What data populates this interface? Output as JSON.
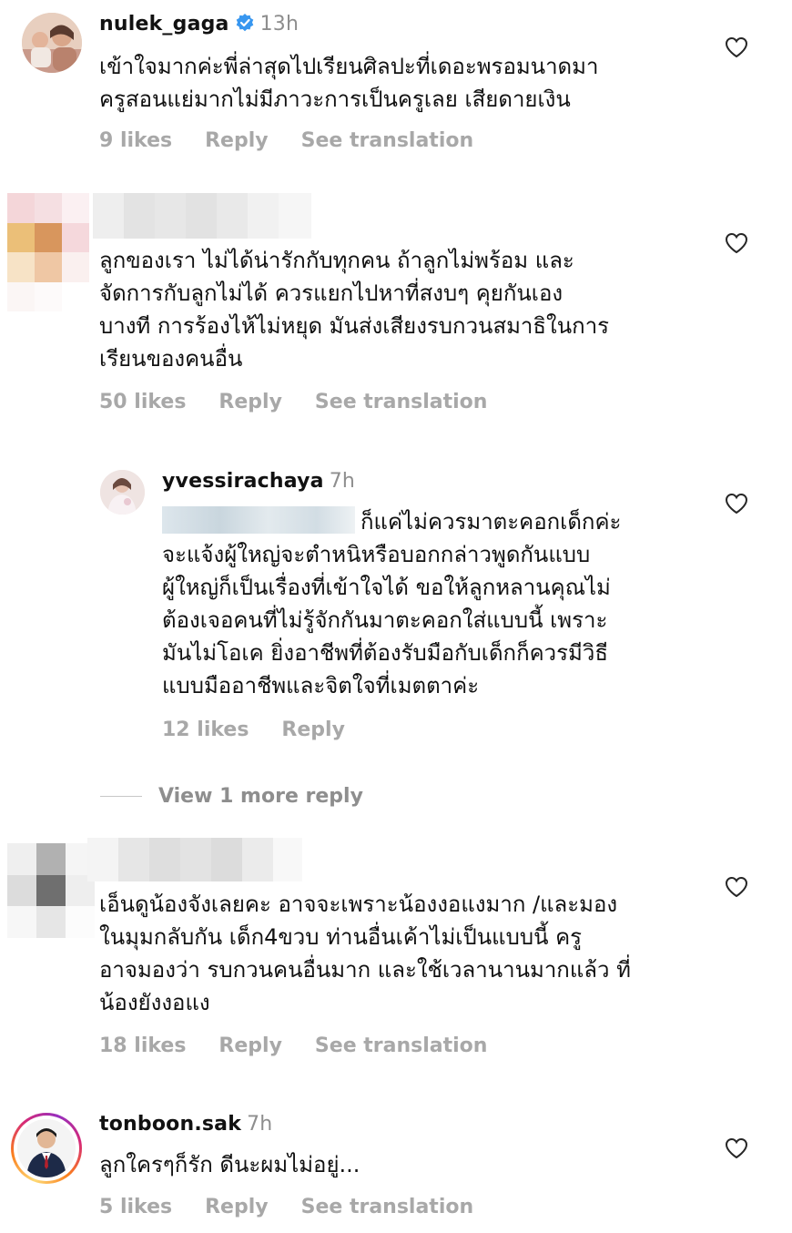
{
  "comments": [
    {
      "username": "nulek_gaga",
      "verified": true,
      "time": "13h",
      "text": "เข้าใจมากค่ะพี่ล่าสุดไปเรียนศิลปะที่เดอะพรอมนาดมา\nครูสอนแย่มากไม่มีภาวะการเป็นครูเลย  เสียดายเงิน",
      "likes": "9 likes",
      "reply": "Reply",
      "translate": "See translation",
      "avatar_icon": "person-photo"
    },
    {
      "username": "",
      "text": "ลูกของเรา ไม่ได้น่ารักกับทุกคน ถ้าลูกไม่พร้อม และ\nจัดการกับลูกไม่ได้ ควรแยกไปหาที่สงบๆ คุยกันเอง\nบางที การร้องไห้ไม่หยุด มันส่งเสียงรบกวนสมาธิในการ\nเรียนของคนอื่น",
      "likes": "50 likes",
      "reply": "Reply",
      "translate": "See translation",
      "avatar_icon": "pixelated-avatar"
    },
    {
      "username": "yvessirachaya",
      "time": "7h",
      "text": "ก็แค่ไม่ควรมาตะคอกเด็กค่ะ\nจะแจ้งผู้ใหญ่จะตำหนิหรือบอกกล่าวพูดกันแบบ\nผู้ใหญ่ก็เป็นเรื่องที่เข้าใจได้ ขอให้ลูกหลานคุณไม่\nต้องเจอคนที่ไม่รู้จักกันมาตะคอกใส่แบบนี้ เพราะ\nมันไม่โอเค ยิ่งอาชีพที่ต้องรับมือกับเด็กก็ควรมีวิธี\nแบบมืออาชีพและจิตใจที่เมตตาค่ะ",
      "likes": "12 likes",
      "reply": "Reply",
      "avatar_icon": "person-photo"
    },
    {
      "username": "",
      "text": "เอ็นดูน้องจังเลยคะ อาจจะเพราะน้องงอแงมาก /และมอง\nในมุมกลับกัน เด็ก4ขวบ ท่านอื่นเค้าไม่เป็นแบบนี้ ครู\nอาจมองว่า รบกวนคนอื่นมาก และใช้เวลานานมากแล้ว ที่\nน้องยังงอแง",
      "likes": "18 likes",
      "reply": "Reply",
      "translate": "See translation",
      "avatar_icon": "pixelated-avatar"
    },
    {
      "username": "tonboon.sak",
      "time": "7h",
      "text": "ลูกใครๆก็รัก ดีนะผมไม่อยู่...",
      "likes": "5 likes",
      "reply": "Reply",
      "translate": "See translation",
      "avatar_icon": "person-suit-photo"
    }
  ],
  "view_more_replies": "View 1 more reply",
  "colors": {
    "meta_gray": "#a8a8a8",
    "username": "#111111",
    "verified_blue": "#3897f0",
    "story_ring": "#d6249f"
  },
  "icons": {
    "like": "heart-outline-icon",
    "verified": "verified-badge-icon"
  }
}
